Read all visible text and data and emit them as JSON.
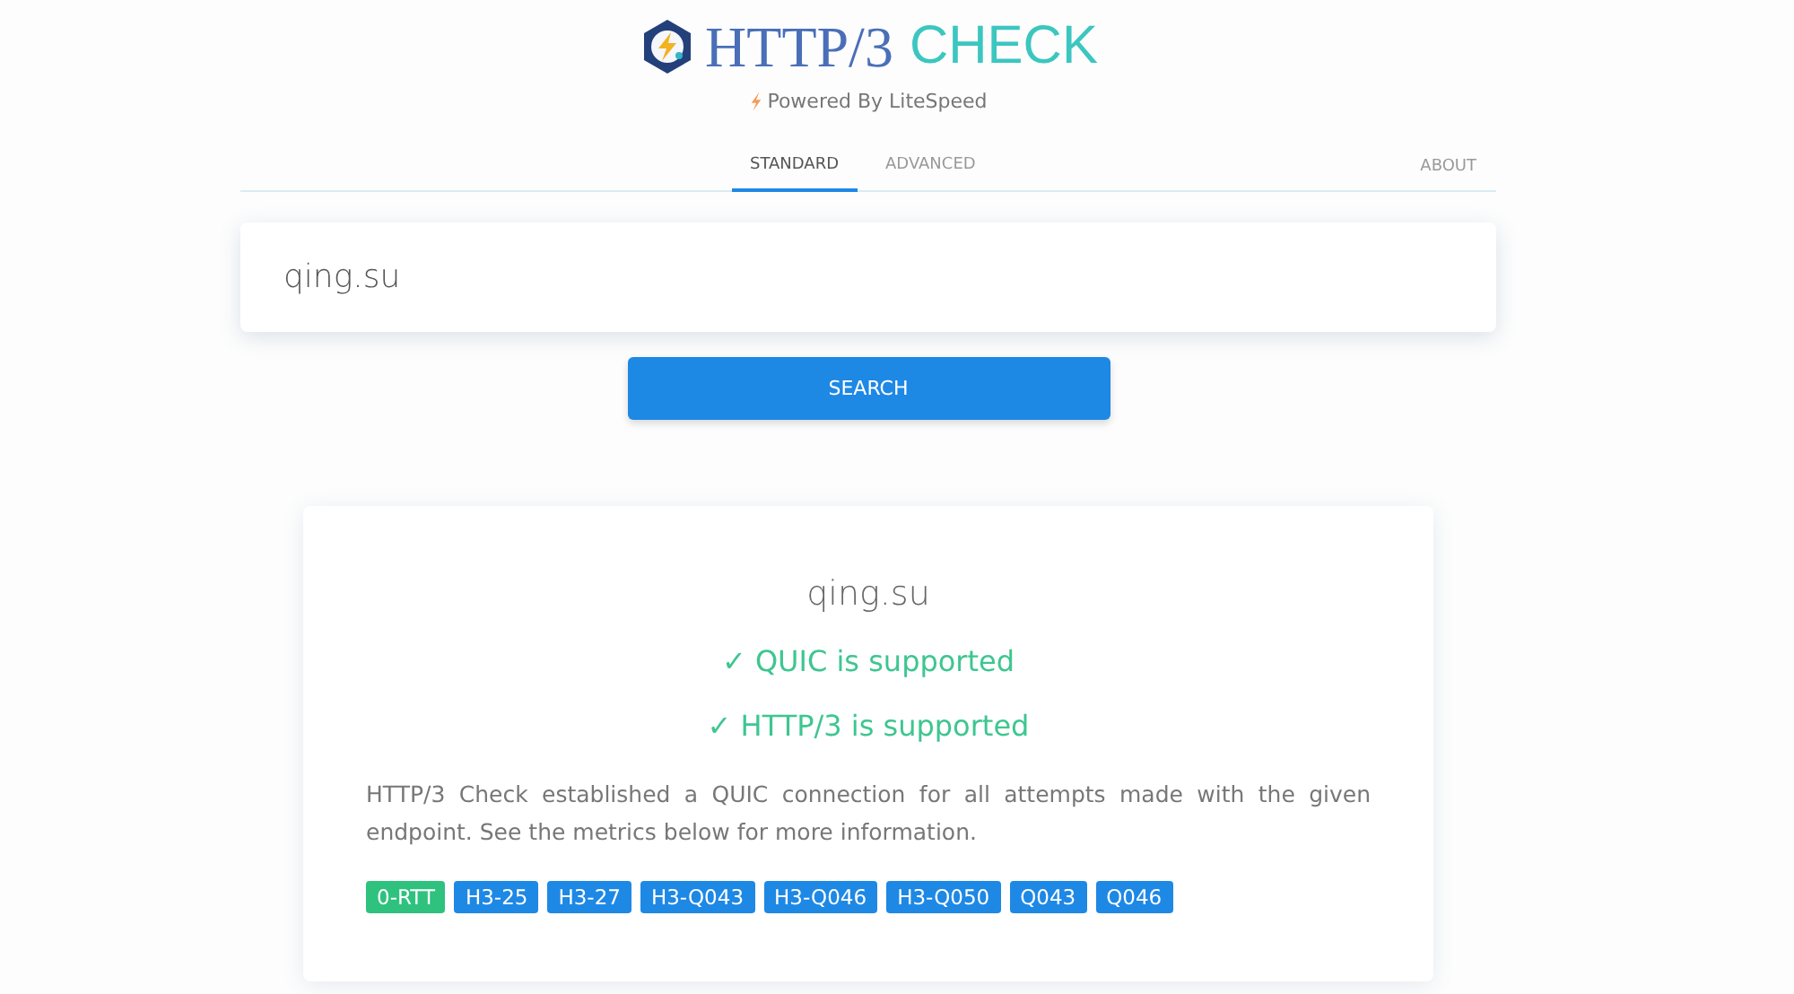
{
  "header": {
    "title_main": "HTTP/3",
    "title_accent": "CHECK",
    "powered_by": "Powered By LiteSpeed"
  },
  "tabs": [
    {
      "label": "STANDARD",
      "selected": true
    },
    {
      "label": "ADVANCED",
      "selected": false
    }
  ],
  "about_link": "ABOUT",
  "search": {
    "value": "qing.su",
    "button": "SEARCH"
  },
  "result": {
    "host": "qing.su",
    "checks": [
      {
        "label": "QUIC is supported",
        "passed": true
      },
      {
        "label": "HTTP/3 is supported",
        "passed": true
      }
    ],
    "mark": "✓",
    "description": "HTTP/3 Check established a QUIC connection for all attempts made with the given endpoint. See the metrics below for more information.",
    "badges": [
      {
        "label": "0-RTT",
        "color": "#2ec27e"
      },
      {
        "label": "H3-25",
        "color": "#1e88e5"
      },
      {
        "label": "H3-27",
        "color": "#1e88e5"
      },
      {
        "label": "H3-Q043",
        "color": "#1e88e5"
      },
      {
        "label": "H3-Q046",
        "color": "#1e88e5"
      },
      {
        "label": "H3-Q050",
        "color": "#1e88e5"
      },
      {
        "label": "Q043",
        "color": "#1e88e5"
      },
      {
        "label": "Q046",
        "color": "#1e88e5"
      }
    ]
  }
}
